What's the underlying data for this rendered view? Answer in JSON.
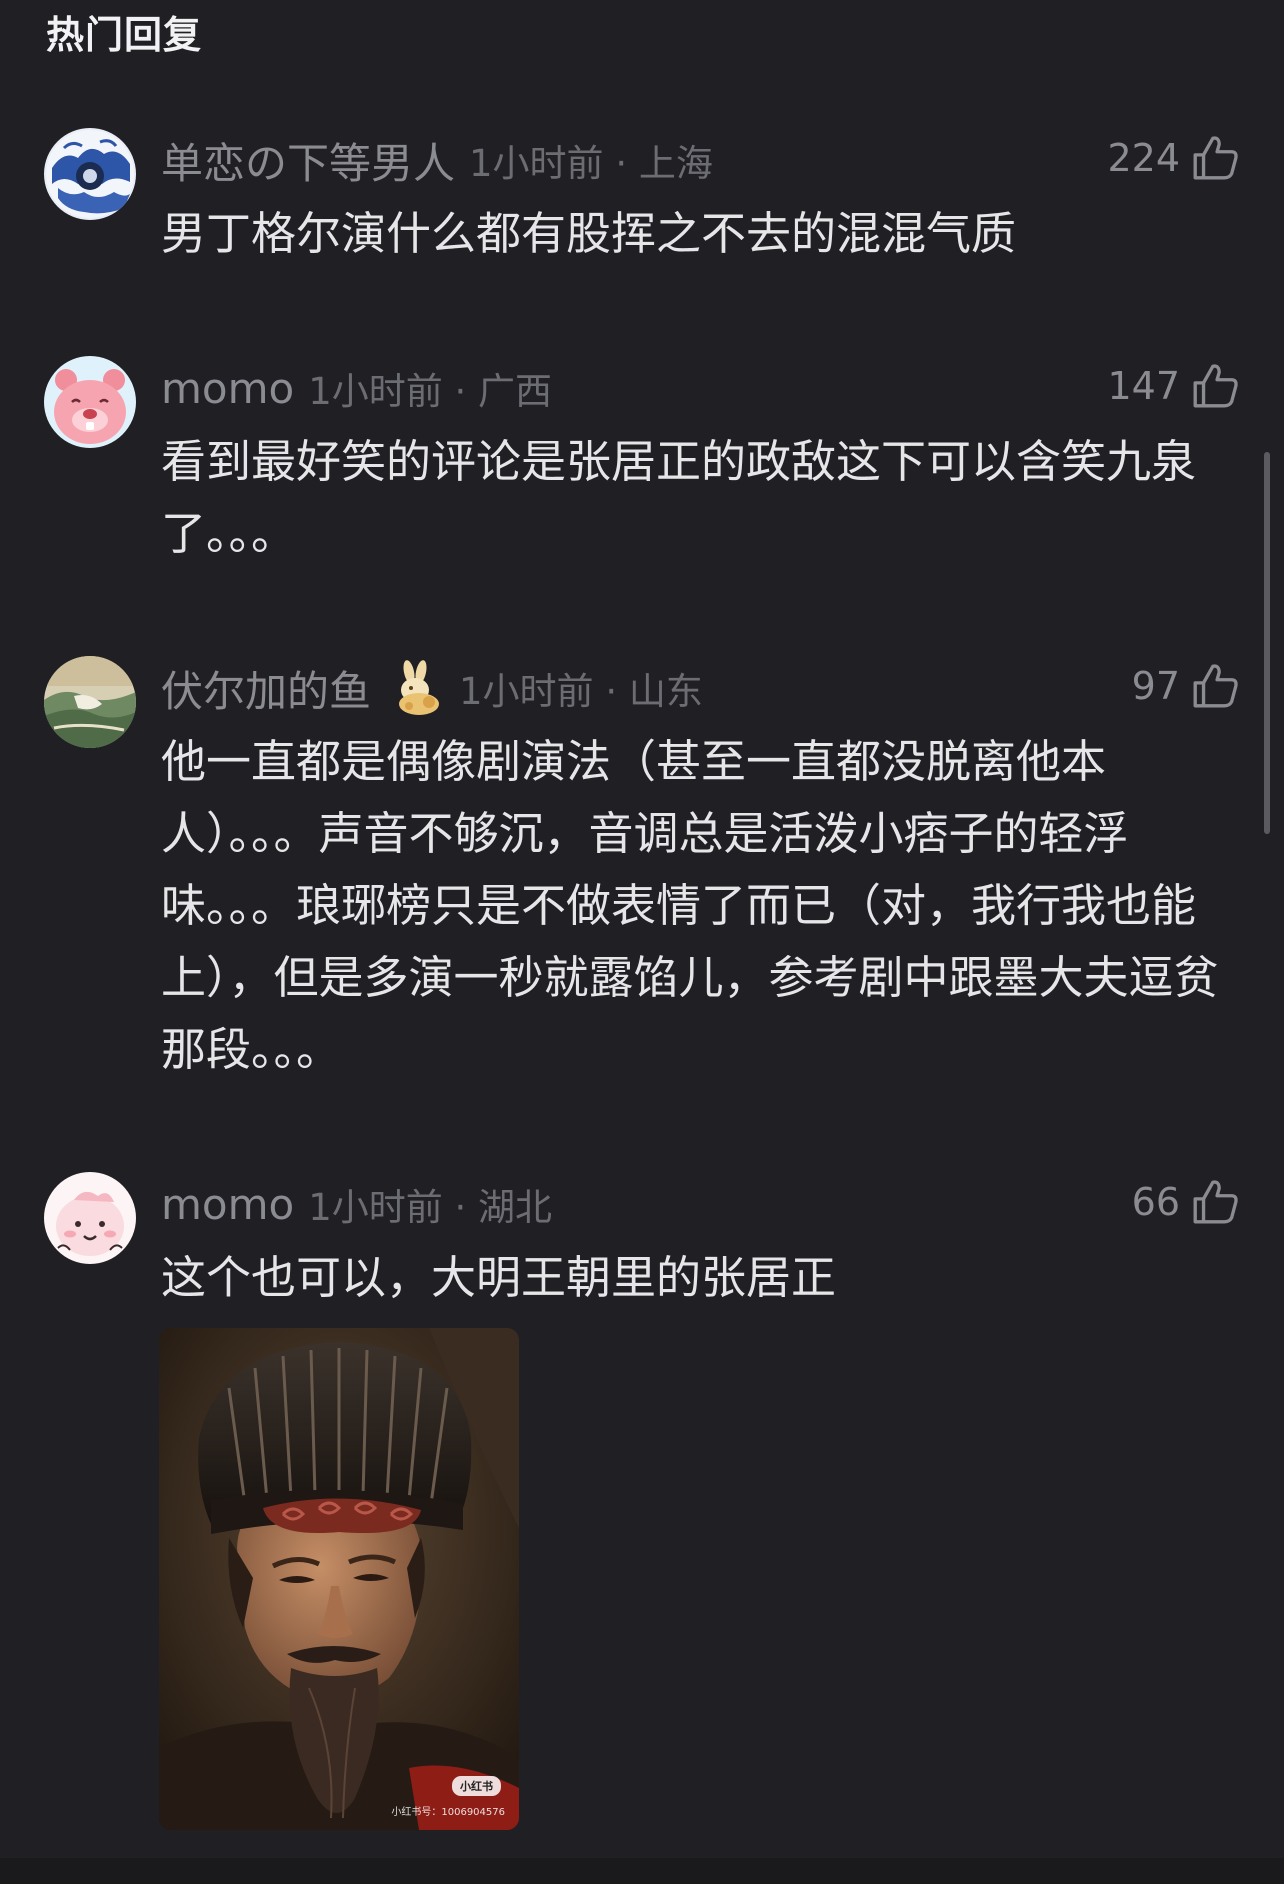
{
  "section_title": "热门回复",
  "comments": [
    {
      "username": "单恋の下等男人",
      "time_location": "1小时前 · 上海",
      "likes": "224",
      "text": "男丁格尔演什么都有股挥之不去的混混气质",
      "avatar_icon": "blue-white-porcelain-avatar-icon",
      "avatar_color": "#2d55a8"
    },
    {
      "username": "momo",
      "time_location": "1小时前 · 广西",
      "likes": "147",
      "text": "看到最好笑的评论是张居正的政敌这下可以含笑九泉了。。。",
      "avatar_icon": "pink-beaver-avatar-icon",
      "avatar_color": "#f4a0a8"
    },
    {
      "username": "伏尔加的鱼",
      "time_location": "1小时前 · 山东",
      "likes": "97",
      "text": "他一直都是偶像剧演法（甚至一直都没脱离他本人）。。。声音不够沉，音调总是活泼小痞子的轻浮味。。。琅琊榜只是不做表情了而已（对，我行我也能上），但是多演一秒就露馅儿，参考剧中跟墨大夫逗贫那段。。。",
      "avatar_icon": "landscape-painting-avatar-icon",
      "badge_icon": "golden-rabbit-badge-icon",
      "avatar_color": "#c9c2a6"
    },
    {
      "username": "momo",
      "time_location": "1小时前 · 湖北",
      "likes": "66",
      "text": "这个也可以，大明王朝里的张居正",
      "avatar_icon": "pink-blob-avatar-icon",
      "avatar_color": "#f7d6db",
      "image": {
        "icon": "ming-official-portrait-photo",
        "watermark_logo": "小红书",
        "watermark_id": "小红书号：1006904576"
      }
    }
  ],
  "like_icon": "thumbs-up-icon",
  "colors": {
    "background": "#202024",
    "primary_text": "#e6e6e8",
    "secondary_text": "#8b8b92",
    "tertiary_text": "#6c6c73"
  }
}
